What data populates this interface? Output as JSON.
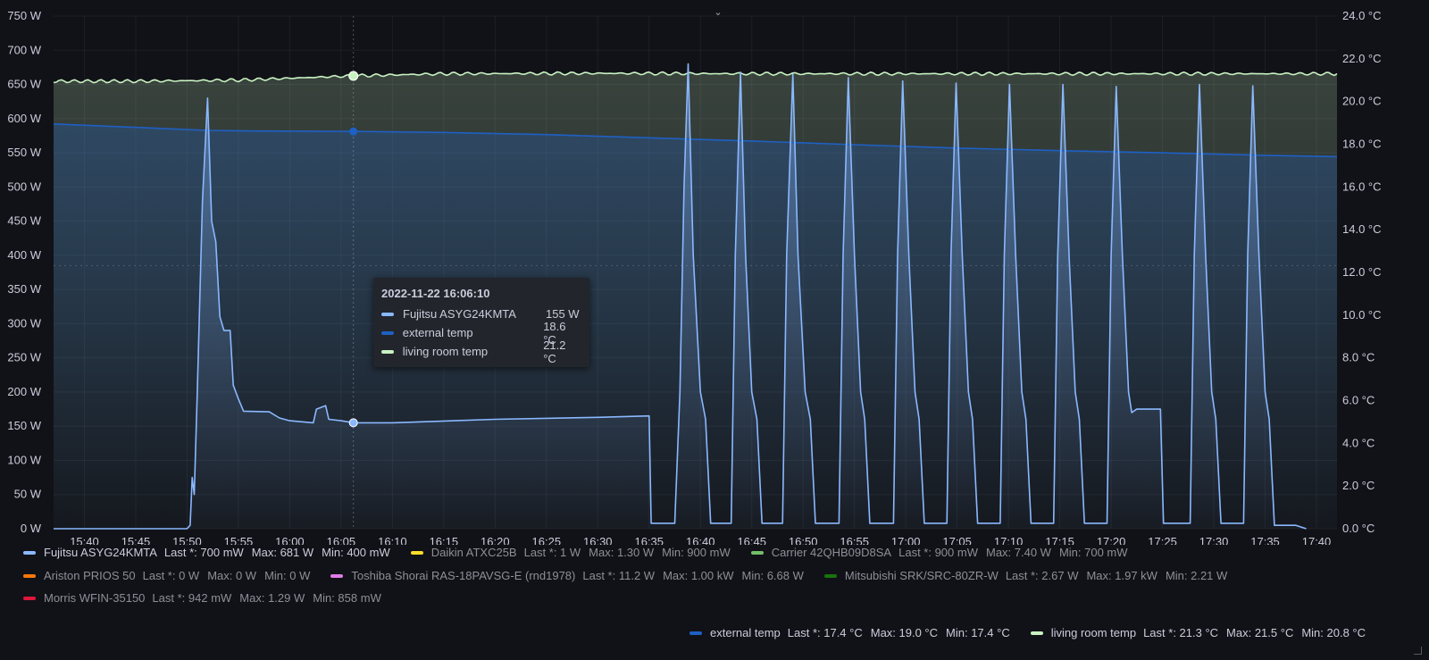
{
  "chart_data": {
    "type": "line",
    "x_ticks": [
      "15:40",
      "15:45",
      "15:50",
      "15:55",
      "16:00",
      "16:05",
      "16:10",
      "16:15",
      "16:20",
      "16:25",
      "16:30",
      "16:35",
      "16:40",
      "16:45",
      "16:50",
      "16:55",
      "17:00",
      "17:05",
      "17:10",
      "17:15",
      "17:20",
      "17:25",
      "17:30",
      "17:35",
      "17:40"
    ],
    "y_left_ticks": [
      "0 W",
      "50 W",
      "100 W",
      "150 W",
      "200 W",
      "250 W",
      "300 W",
      "350 W",
      "400 W",
      "450 W",
      "500 W",
      "550 W",
      "600 W",
      "650 W",
      "700 W",
      "750 W"
    ],
    "y_right_ticks": [
      "0.0 °C",
      "2.0 °C",
      "4.0 °C",
      "6.0 °C",
      "8.0 °C",
      "10.0 °C",
      "12.0 °C",
      "14.0 °C",
      "16.0 °C",
      "18.0 °C",
      "20.0 °C",
      "22.0 °C",
      "24.0 °C"
    ],
    "ylim_left": [
      0,
      750
    ],
    "ylim_right": [
      0,
      24
    ],
    "xlim": [
      "15:37",
      "17:42"
    ],
    "threshold_dashed_w": 385,
    "series": [
      {
        "name": "Fujitsu ASYG24KMTA",
        "axis": "left",
        "color": "#8ab8ff",
        "points": [
          [
            "15:37",
            0
          ],
          [
            "15:50",
            0
          ],
          [
            "15:50.3",
            5
          ],
          [
            "15:50.5",
            75
          ],
          [
            "15:50.7",
            50
          ],
          [
            "15:51",
            200
          ],
          [
            "15:51.5",
            480
          ],
          [
            "15:52",
            630
          ],
          [
            "15:52.4",
            450
          ],
          [
            "15:52.8",
            420
          ],
          [
            "15:53.2",
            310
          ],
          [
            "15:53.6",
            290
          ],
          [
            "15:54.2",
            290
          ],
          [
            "15:54.5",
            210
          ],
          [
            "15:55",
            190
          ],
          [
            "15:55.5",
            172
          ],
          [
            "15:58",
            171
          ],
          [
            "15:59",
            162
          ],
          [
            "16:00",
            158
          ],
          [
            "16:02.3",
            155
          ],
          [
            "16:02.6",
            175
          ],
          [
            "16:03.5",
            180
          ],
          [
            "16:03.8",
            160
          ],
          [
            "16:05",
            158
          ],
          [
            "16:06.2",
            155
          ],
          [
            "16:10",
            155
          ],
          [
            "16:20",
            160
          ],
          [
            "16:30",
            163
          ],
          [
            "16:35",
            165
          ],
          [
            "16:35.2",
            8
          ],
          [
            "16:37.5",
            8
          ],
          [
            "16:38",
            200
          ],
          [
            "16:38.4",
            500
          ],
          [
            "16:38.8",
            680
          ],
          [
            "16:39.3",
            400
          ],
          [
            "16:40",
            200
          ],
          [
            "16:40.5",
            160
          ],
          [
            "16:41",
            8
          ],
          [
            "16:43",
            8
          ],
          [
            "16:43.4",
            400
          ],
          [
            "16:43.9",
            668
          ],
          [
            "16:44.4",
            400
          ],
          [
            "16:45",
            200
          ],
          [
            "16:45.5",
            160
          ],
          [
            "16:46",
            8
          ],
          [
            "16:48",
            8
          ],
          [
            "16:48.4",
            400
          ],
          [
            "16:49",
            665
          ],
          [
            "16:49.5",
            400
          ],
          [
            "16:50.2",
            200
          ],
          [
            "16:50.7",
            160
          ],
          [
            "16:51.2",
            8
          ],
          [
            "16:53.5",
            8
          ],
          [
            "16:53.9",
            400
          ],
          [
            "16:54.4",
            660
          ],
          [
            "16:55",
            400
          ],
          [
            "16:55.6",
            200
          ],
          [
            "16:56",
            160
          ],
          [
            "16:56.5",
            8
          ],
          [
            "16:58.8",
            8
          ],
          [
            "16:59.2",
            400
          ],
          [
            "16:59.7",
            655
          ],
          [
            "17:00.3",
            400
          ],
          [
            "17:00.9",
            200
          ],
          [
            "17:01.3",
            160
          ],
          [
            "17:01.8",
            8
          ],
          [
            "17:04",
            8
          ],
          [
            "17:04.4",
            400
          ],
          [
            "17:04.9",
            652
          ],
          [
            "17:05.5",
            400
          ],
          [
            "17:06.1",
            200
          ],
          [
            "17:06.5",
            160
          ],
          [
            "17:07",
            8
          ],
          [
            "17:09.2",
            8
          ],
          [
            "17:09.6",
            400
          ],
          [
            "17:10.1",
            650
          ],
          [
            "17:10.7",
            400
          ],
          [
            "17:11.3",
            200
          ],
          [
            "17:11.7",
            160
          ],
          [
            "17:12.2",
            8
          ],
          [
            "17:14.4",
            8
          ],
          [
            "17:14.8",
            400
          ],
          [
            "17:15.3",
            650
          ],
          [
            "17:15.9",
            400
          ],
          [
            "17:16.5",
            200
          ],
          [
            "17:16.9",
            160
          ],
          [
            "17:17.4",
            8
          ],
          [
            "17:19.6",
            8
          ],
          [
            "17:20",
            400
          ],
          [
            "17:20.5",
            647
          ],
          [
            "17:21.1",
            400
          ],
          [
            "17:21.7",
            200
          ],
          [
            "17:22",
            170
          ],
          [
            "17:22.5",
            175
          ],
          [
            "17:24.8",
            175
          ],
          [
            "17:25.1",
            8
          ],
          [
            "17:27.7",
            8
          ],
          [
            "17:28.1",
            400
          ],
          [
            "17:28.6",
            650
          ],
          [
            "17:29.2",
            400
          ],
          [
            "17:29.8",
            200
          ],
          [
            "17:30.2",
            160
          ],
          [
            "17:30.7",
            8
          ],
          [
            "17:32.9",
            8
          ],
          [
            "17:33.3",
            400
          ],
          [
            "17:33.8",
            648
          ],
          [
            "17:34.4",
            400
          ],
          [
            "17:35",
            200
          ],
          [
            "17:35.4",
            160
          ],
          [
            "17:35.9",
            5
          ],
          [
            "17:37",
            5
          ],
          [
            "17:38",
            5
          ],
          [
            "17:39",
            0
          ]
        ]
      },
      {
        "name": "external temp",
        "axis": "right",
        "color": "#1f60c4",
        "points": [
          [
            "15:37",
            18.95
          ],
          [
            "15:42",
            18.85
          ],
          [
            "15:47",
            18.75
          ],
          [
            "15:52",
            18.65
          ],
          [
            "15:57",
            18.62
          ],
          [
            "16:06",
            18.6
          ],
          [
            "16:15",
            18.55
          ],
          [
            "16:25",
            18.45
          ],
          [
            "16:35",
            18.3
          ],
          [
            "16:45",
            18.15
          ],
          [
            "16:55",
            17.98
          ],
          [
            "17:05",
            17.82
          ],
          [
            "17:15",
            17.7
          ],
          [
            "17:25",
            17.6
          ],
          [
            "17:35",
            17.48
          ],
          [
            "17:42",
            17.42
          ]
        ]
      },
      {
        "name": "living room temp",
        "axis": "right",
        "color": "#c8f2c2",
        "points": [
          [
            "15:37",
            20.95
          ],
          [
            "15:45",
            20.95
          ],
          [
            "15:55",
            21.0
          ],
          [
            "16:06",
            21.2
          ],
          [
            "16:15",
            21.3
          ],
          [
            "16:30",
            21.32
          ],
          [
            "16:45",
            21.3
          ],
          [
            "17:00",
            21.3
          ],
          [
            "17:15",
            21.3
          ],
          [
            "17:30",
            21.3
          ],
          [
            "17:42",
            21.3
          ]
        ]
      }
    ],
    "tooltip": {
      "time": "2022-11-22 16:06:10",
      "rows": [
        {
          "name": "Fujitsu ASYG24KMTA",
          "value": "155 W",
          "color": "#8ab8ff"
        },
        {
          "name": "external temp",
          "value": "18.6 °C",
          "color": "#1f60c4"
        },
        {
          "name": "living room temp",
          "value": "21.2 °C",
          "color": "#c8f2c2"
        }
      ]
    }
  },
  "legend": {
    "row1": [
      {
        "name": "Fujitsu ASYG24KMTA",
        "color": "#8ab8ff",
        "last": "Last *: 700 mW",
        "max": "Max: 681 W",
        "min": "Min: 400 mW",
        "active": true
      },
      {
        "name": "Daikin ATXC25B",
        "color": "#fade2a",
        "last": "Last *: 1 W",
        "max": "Max: 1.30 W",
        "min": "Min: 900 mW",
        "active": false
      },
      {
        "name": "Carrier 42QHB09D8SA",
        "color": "#73bf69",
        "last": "Last *: 900 mW",
        "max": "Max: 7.40 W",
        "min": "Min: 700 mW",
        "active": false
      }
    ],
    "row2": [
      {
        "name": "Ariston PRIOS 50",
        "color": "#ff780a",
        "last": "Last *: 0 W",
        "max": "Max: 0 W",
        "min": "Min: 0 W",
        "active": false
      },
      {
        "name": "Toshiba Shorai RAS-18PAVSG-E (rnd1978)",
        "color": "#e07ce8",
        "last": "Last *: 11.2 W",
        "max": "Max: 1.00 kW",
        "min": "Min: 6.68 W",
        "active": false
      },
      {
        "name": "Mitsubishi SRK/SRC-80ZR-W",
        "color": "#19730e",
        "last": "Last *: 2.67 W",
        "max": "Max: 1.97 kW",
        "min": "Min: 2.21 W",
        "active": false
      }
    ],
    "row3": [
      {
        "name": "Morris WFIN-35150",
        "color": "#e0163c",
        "last": "Last *: 942 mW",
        "max": "Max: 1.29 W",
        "min": "Min: 858 mW",
        "active": false
      }
    ],
    "row4": [
      {
        "name": "external temp",
        "color": "#1f60c4",
        "last": "Last *: 17.4 °C",
        "max": "Max: 19.0 °C",
        "min": "Min: 17.4 °C",
        "active": true
      },
      {
        "name": "living room temp",
        "color": "#c8f2c2",
        "last": "Last *: 21.3 °C",
        "max": "Max: 21.5 °C",
        "min": "Min: 20.8 °C",
        "active": true
      }
    ]
  },
  "icons": {
    "collapse": "chevron-down-icon",
    "resize": "resize-handle-icon"
  }
}
